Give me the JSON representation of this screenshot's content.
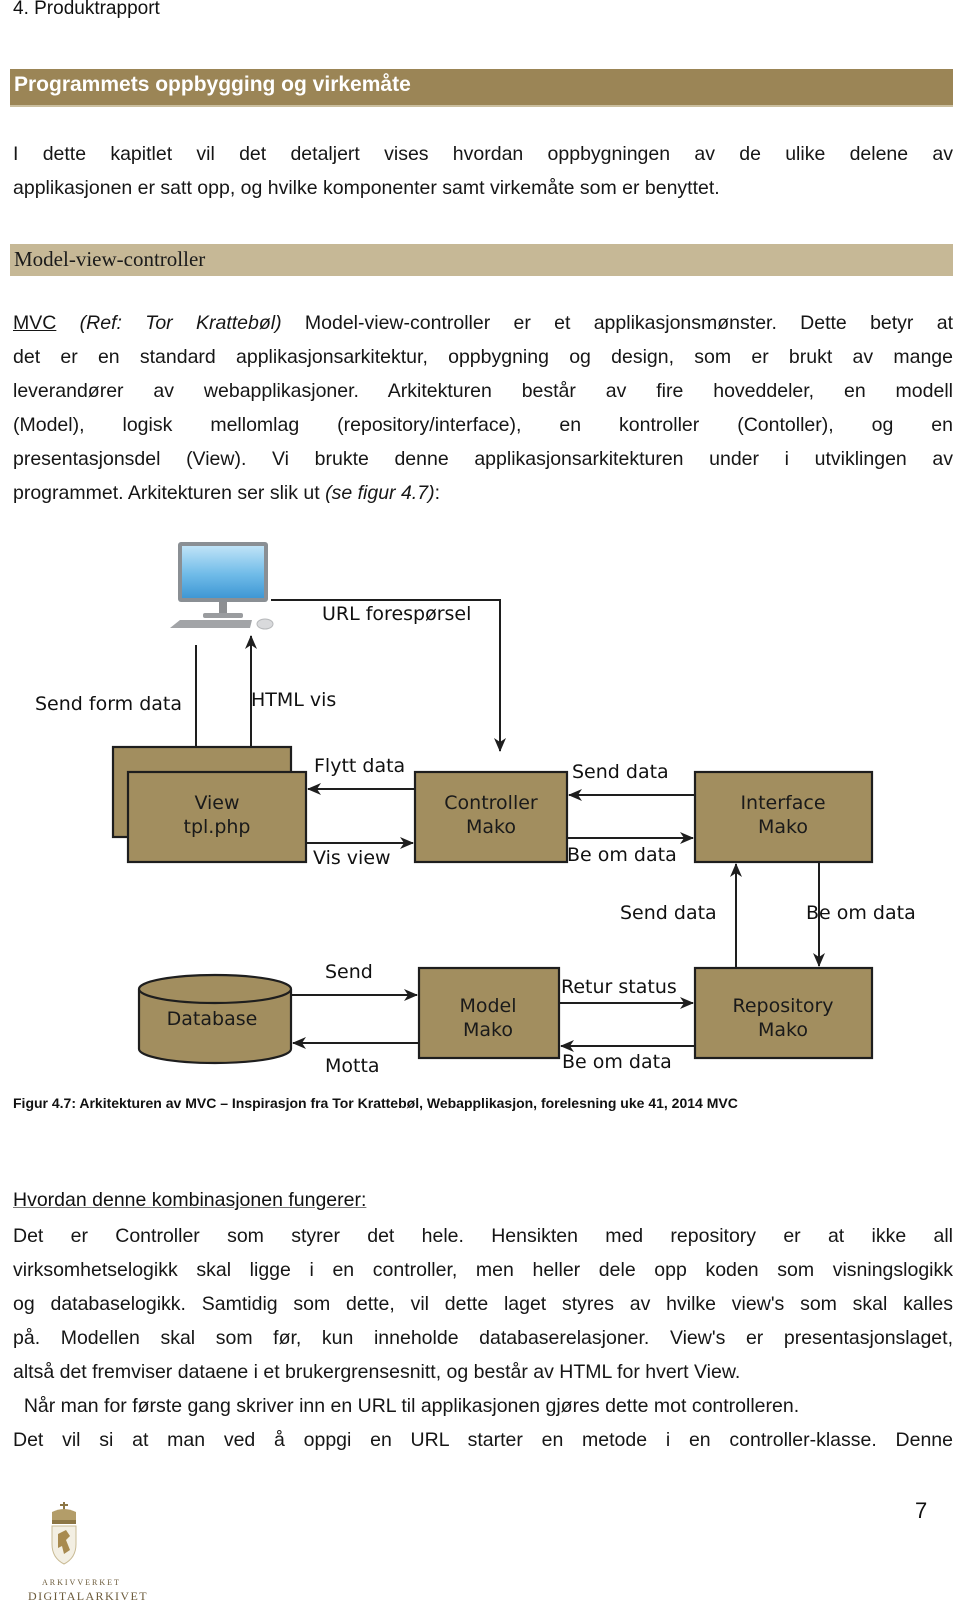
{
  "document": {
    "running_head": "4. Produktrapport",
    "page_number": "7",
    "colors": {
      "heading1_bar": "#9b8556",
      "heading2_bar": "#c6b896",
      "diagram_box": "#a28e5f"
    }
  },
  "section": {
    "heading": "Programmets oppbygging og virkemåte",
    "intro_lines": [
      "I dette kapitlet vil det detaljert vises hvordan oppbygningen av de ulike delene av",
      "applikasjonen er satt opp, og hvilke komponenter samt virkemåte som er benyttet."
    ]
  },
  "mvc": {
    "heading": "Model-view-controller",
    "line1": {
      "abbr": "MVC",
      "ref": "(Ref: Tor Krattebøl)",
      "rest": " Model-view-controller er et applikasjonsmønster. Dette betyr at"
    },
    "lines": [
      "det er en standard applikasjonsarkitektur, oppbygning og design, som er brukt av mange",
      "leverandører av webapplikasjoner. Arkitekturen består av fire hoveddeler, en modell",
      "(Model), logisk mellomlag (repository/interface), en kontroller (Contoller), og en",
      "presentasjonsdel (View). Vi brukte denne applikasjonsarkitekturen under i utviklingen av"
    ],
    "last_line": {
      "text": "programmet. Arkitekturen ser slik ut ",
      "ref": "(se figur 4.7)",
      "end": ":"
    }
  },
  "diagram": {
    "client_icon": "desktop-computer-icon",
    "boxes": {
      "view": [
        "View",
        "tpl.php"
      ],
      "controller": [
        "Controller",
        "Mako"
      ],
      "interface": [
        "Interface",
        "Mako"
      ],
      "model": [
        "Model",
        "Mako"
      ],
      "repository": [
        "Repository",
        "Mako"
      ],
      "database": "Database"
    },
    "arrows": {
      "url_request": "URL forespørsel",
      "send_form_data": "Send form data",
      "html_show": "HTML vis",
      "move_data": "Flytt data",
      "show_view": "Vis view",
      "ctrl_send_data": "Send data",
      "ctrl_request_data": "Be om data",
      "iface_send_data": "Send data",
      "iface_request_data": "Be om data",
      "db_send": "Send",
      "db_receive": "Motta",
      "return_status": "Retur status",
      "model_request_data": "Be om data"
    },
    "caption": "Figur 4.7: Arkitekturen av MVC – Inspirasjon fra Tor Krattebøl, Webapplikasjon, forelesning uke 41, 2014 MVC"
  },
  "combination": {
    "heading": "Hvordan denne kombinasjonen fungerer:",
    "lines": [
      "Det er Controller som styrer det hele. Hensikten med repository er at ikke all",
      "virksomhetselogikk skal ligge i en controller, men heller dele opp koden som visningslogikk",
      "og databaselogikk.  Samtidig som dette, vil dette laget styres av hvilke view's som skal kalles",
      "på. Modellen skal som før, kun inneholde databaserelasjoner. View's er presentasjonslaget,",
      "altså det fremviser dataene i et brukergrensesnitt, og består av HTML for hvert View."
    ],
    "para2_lines": [
      "  Når man for første gang skriver inn en URL til applikasjonen gjøres dette mot controlleren.",
      "Det vil si at man ved å oppgi en URL starter en metode i en controller-klasse. Denne"
    ]
  },
  "footer": {
    "logo_line1": "ARKIVVERKET",
    "logo_line2": "DIGITALARKIVET"
  }
}
